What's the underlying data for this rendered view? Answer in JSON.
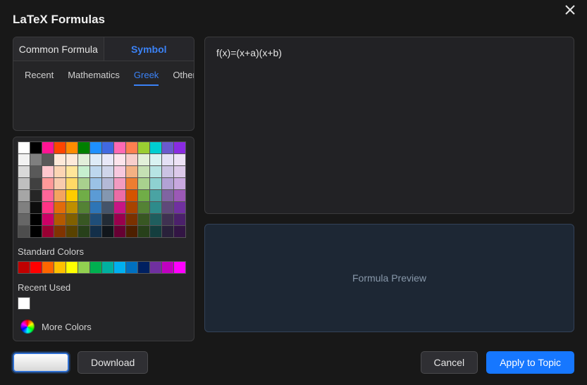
{
  "title": "LaTeX Formulas",
  "main_tabs": {
    "common": "Common Formula",
    "symbol": "Symbol",
    "active": "symbol"
  },
  "sub_tabs": {
    "items": [
      "Recent",
      "Mathematics",
      "Greek",
      "Other"
    ],
    "active": "Greek"
  },
  "color_panel": {
    "rows": [
      [
        "#ffffff",
        "#000000",
        "#ff1493",
        "#ff4500",
        "#ff8c00",
        "#008000",
        "#1e90ff",
        "#4169e1",
        "#ff69b4",
        "#ff7f50",
        "#9acd32",
        "#00ced1",
        "#6a5acd",
        "#8a2be2"
      ],
      [
        "#f2f2f2",
        "#7f7f7f",
        "#595959",
        "#fde9d9",
        "#fdeada",
        "#e2efda",
        "#deebf7",
        "#e8e8f8",
        "#fce4ec",
        "#f8cecc",
        "#e2f0d9",
        "#d9f2f2",
        "#e4e0f5",
        "#ede2f6"
      ],
      [
        "#d9d9d9",
        "#595959",
        "#ffc7ce",
        "#fcd5b4",
        "#ffe699",
        "#c6efce",
        "#bdd7ee",
        "#cfd5ea",
        "#f7c8de",
        "#f4b183",
        "#c5e0b4",
        "#b7e4e4",
        "#cbc3e3",
        "#dcc9ea"
      ],
      [
        "#bfbfbf",
        "#404040",
        "#ff9999",
        "#f8cbad",
        "#ffd966",
        "#a9d08e",
        "#9bc2e6",
        "#b4b9d6",
        "#f29bc1",
        "#ed7d31",
        "#a9d18e",
        "#8ed1d1",
        "#b2a2d4",
        "#c8a8df"
      ],
      [
        "#a6a6a6",
        "#262626",
        "#ff6699",
        "#f4a460",
        "#ffcc00",
        "#70ad47",
        "#5b9bd5",
        "#8497b0",
        "#ec6ca5",
        "#d35400",
        "#70ad47",
        "#4aa3a3",
        "#8064a2",
        "#9b59b6"
      ],
      [
        "#808080",
        "#0d0d0d",
        "#ff3385",
        "#e26b0a",
        "#bf8f00",
        "#548235",
        "#2e75b6",
        "#44546a",
        "#c71585",
        "#a84300",
        "#548235",
        "#2e8b8b",
        "#5f497a",
        "#7030a0"
      ],
      [
        "#666666",
        "#000000",
        "#cc0066",
        "#b35900",
        "#806000",
        "#385723",
        "#1f4e79",
        "#222b35",
        "#99004d",
        "#7a3100",
        "#385723",
        "#1f5e5e",
        "#3f3151",
        "#4b206b"
      ],
      [
        "#4d4d4d",
        "#000000",
        "#990033",
        "#803300",
        "#594200",
        "#27401a",
        "#132f49",
        "#11161b",
        "#660033",
        "#4d1f00",
        "#27401a",
        "#143e3e",
        "#29213a",
        "#321544"
      ]
    ],
    "standard_label": "Standard Colors",
    "standard_row": [
      "#c00000",
      "#ff0000",
      "#ff6600",
      "#ffc000",
      "#ffff00",
      "#92d050",
      "#00b050",
      "#00b0a0",
      "#00b0f0",
      "#0070c0",
      "#002060",
      "#7030a0",
      "#c000c0",
      "#ff00ff"
    ],
    "recent_label": "Recent Used",
    "recent_row": [
      "#ffffff"
    ],
    "more_label": "More Colors"
  },
  "editor_text": "f(x)=(x+a)(x+b)",
  "preview_label": "Formula Preview",
  "buttons": {
    "download": "Download",
    "cancel": "Cancel",
    "apply": "Apply to Topic"
  }
}
